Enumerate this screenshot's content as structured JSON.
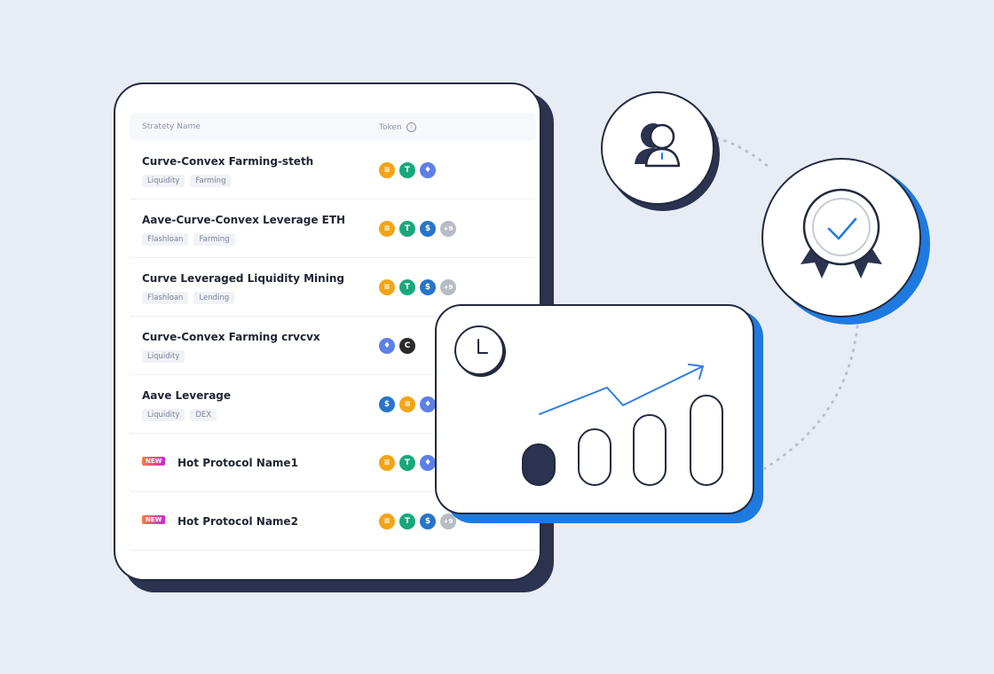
{
  "table": {
    "header": {
      "name_label": "Stratety Name",
      "token_label": "Token"
    },
    "rows": [
      {
        "title": "Curve-Convex Farming-steth",
        "tags": [
          "Liquidity",
          "Farming"
        ],
        "tokens": [
          "coin",
          "tether",
          "eth"
        ]
      },
      {
        "title": "Aave-Curve-Convex Leverage ETH",
        "tags": [
          "Flashloan",
          "Farming"
        ],
        "tokens": [
          "coin",
          "tether",
          "usdc"
        ],
        "more": "+9"
      },
      {
        "title": "Curve Leveraged Liquidity Mining",
        "tags": [
          "Flashloan",
          "Lending"
        ],
        "tokens": [
          "coin",
          "tether",
          "usdc"
        ],
        "more": "+9"
      },
      {
        "title": "Curve-Convex Farming crvcvx",
        "tags": [
          "Liquidity"
        ],
        "tokens": [
          "eth",
          "cvx"
        ]
      },
      {
        "title": "Aave Leverage",
        "tags": [
          "Liquidity",
          "DEX"
        ],
        "tokens": [
          "usdc",
          "coin",
          "eth"
        ]
      },
      {
        "title": "Hot Protocol Name1",
        "badge": "NEW",
        "tokens": [
          "coin",
          "tether",
          "eth"
        ]
      },
      {
        "title": "Hot Protocol Name2",
        "badge": "NEW",
        "tokens": [
          "coin",
          "tether",
          "usdc"
        ],
        "more": "+9"
      }
    ]
  },
  "token_glyphs": {
    "coin": "≡",
    "tether": "T",
    "eth": "♦",
    "usdc": "$",
    "cvx": "C"
  },
  "colors": {
    "background": "#e8edf5",
    "dark": "#232a40",
    "accent": "#1f7ae0",
    "new_badge_start": "#ff7a3c",
    "new_badge_end": "#c32bd8"
  },
  "icons": [
    "user-icon",
    "award-badge-icon",
    "check-icon",
    "clock-icon",
    "trend-arrow-icon",
    "info-icon"
  ]
}
